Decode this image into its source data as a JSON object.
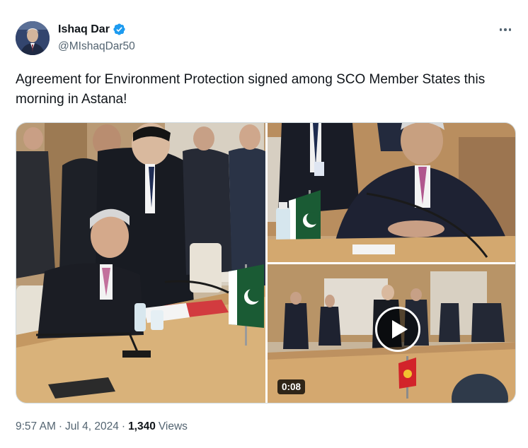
{
  "author": {
    "name": "Ishaq Dar",
    "handle": "@MIshaqDar50",
    "verified": true,
    "verified_icon": "verified-badge-icon",
    "verified_color": "#1d9bf0"
  },
  "tweet": {
    "text": "Agreement for Environment Protection signed among SCO Member States this morning in Astana!"
  },
  "media": {
    "video": {
      "duration": "0:08",
      "play_icon": "play-icon"
    }
  },
  "footer": {
    "time": "9:57 AM",
    "dot1": "·",
    "date": "Jul 4, 2024",
    "dot2": "·",
    "views_count": "1,340",
    "views_label": "Views"
  },
  "colors": {
    "text_primary": "#0f1419",
    "text_secondary": "#536471",
    "accent": "#1d9bf0"
  }
}
